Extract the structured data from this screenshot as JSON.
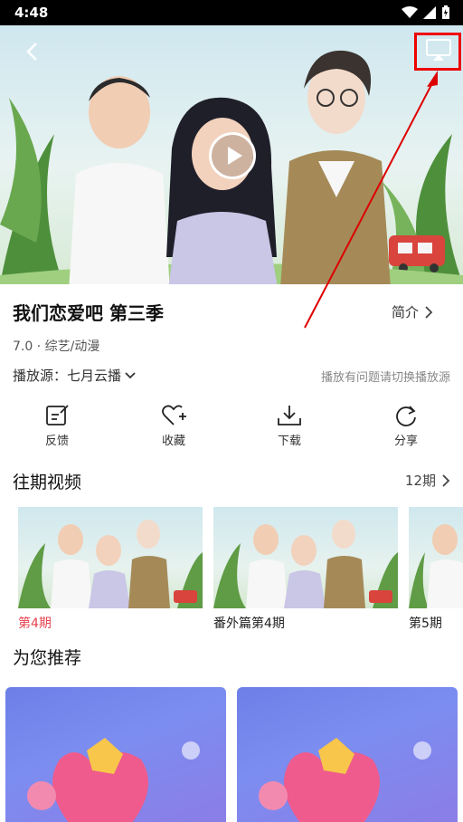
{
  "status_bar": {
    "time": "4:48"
  },
  "show": {
    "title": "我们恋爱吧 第三季",
    "intro_label": "简介",
    "meta": "7.0 · 综艺/动漫",
    "source_label": "播放源：七月云播",
    "source_hint": "播放有问题请切换播放源"
  },
  "actions": [
    {
      "label": "反馈",
      "icon": "feedback-icon"
    },
    {
      "label": "收藏",
      "icon": "favorite-icon"
    },
    {
      "label": "下载",
      "icon": "download-icon"
    },
    {
      "label": "分享",
      "icon": "share-icon"
    }
  ],
  "episodes": {
    "title": "往期视频",
    "count": "12期",
    "items": [
      {
        "label": "第4期",
        "active": true
      },
      {
        "label": "番外篇第4期",
        "active": false
      },
      {
        "label": "第5期",
        "active": false
      }
    ]
  },
  "recommend": {
    "title": "为您推荐"
  },
  "colors": {
    "accent": "#e8434f",
    "annotation": "#dd0000"
  }
}
